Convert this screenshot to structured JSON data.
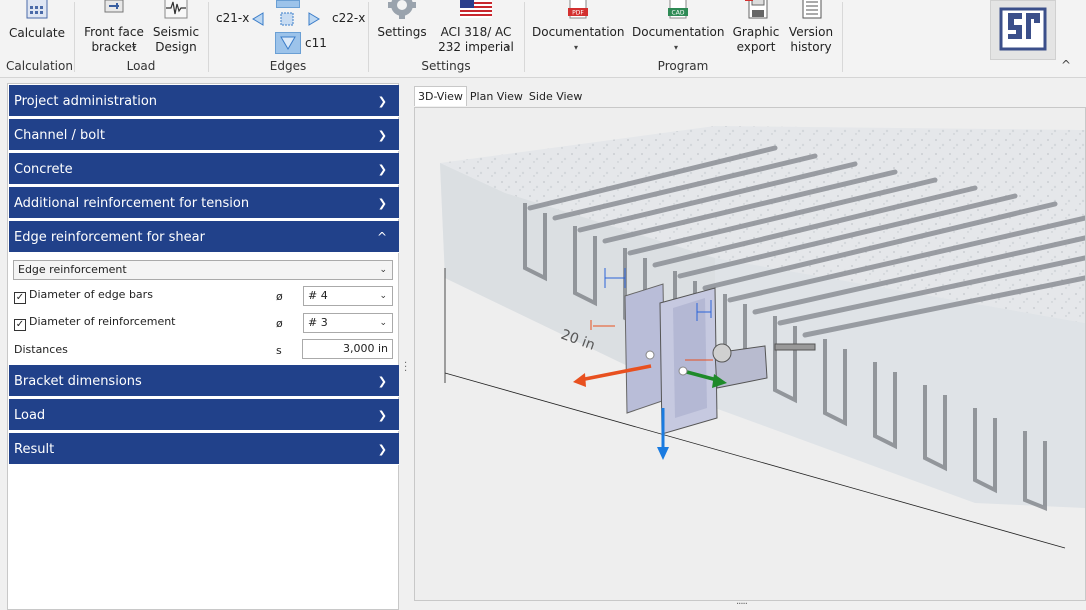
{
  "ribbon": {
    "calculate": "Calculate",
    "front_face_bracket": "Front face bracket",
    "seismic_design": "Seismic Design",
    "edge_c21x": "c21-x",
    "edge_c22x": "c22-x",
    "edge_c11": "c11",
    "settings": "Settings",
    "standard": "ACI 318/ AC 232 imperial",
    "documentation_pdf": "Documentation",
    "documentation_cad": "Documentation",
    "graphic_export": "Graphic export",
    "version_history": "Version history",
    "groups": {
      "calculation": "Calculation",
      "load": "Load",
      "edges": "Edges",
      "settings": "Settings",
      "program": "Program"
    }
  },
  "panel": {
    "sections": [
      {
        "label": "Project administration"
      },
      {
        "label": "Channel / bolt"
      },
      {
        "label": "Concrete"
      },
      {
        "label": "Additional reinforcement for tension"
      },
      {
        "label": "Edge reinforcement for shear"
      },
      {
        "label": "Bracket dimensions"
      },
      {
        "label": "Load"
      },
      {
        "label": "Result"
      }
    ],
    "edge_reinforcement_select": "Edge reinforcement",
    "diameter_edge_bars_label": "Diameter of edge bars",
    "diameter_edge_bars_symbol": "ø",
    "diameter_edge_bars_value": "# 4",
    "diameter_reinforcement_label": "Diameter of reinforcement",
    "diameter_reinforcement_symbol": "ø",
    "diameter_reinforcement_value": "# 3",
    "distances_label": "Distances",
    "distances_symbol": "s",
    "distances_value": "3,000 in"
  },
  "view": {
    "tabs": [
      "3D-View",
      "Plan View",
      "Side View"
    ],
    "active_tab": "3D-View",
    "dimension_label": "20 in"
  },
  "colors": {
    "accordion": "#21418a",
    "arrow_red": "#e8501f",
    "arrow_green": "#1e8a2a",
    "arrow_blue": "#1a7be0"
  }
}
